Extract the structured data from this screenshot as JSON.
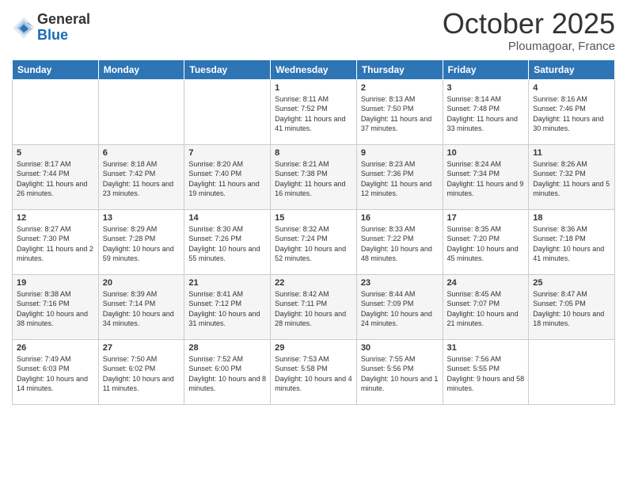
{
  "logo": {
    "general": "General",
    "blue": "Blue"
  },
  "title": "October 2025",
  "location": "Ploumagoar, France",
  "days_of_week": [
    "Sunday",
    "Monday",
    "Tuesday",
    "Wednesday",
    "Thursday",
    "Friday",
    "Saturday"
  ],
  "weeks": [
    [
      {
        "day": "",
        "sunrise": "",
        "sunset": "",
        "daylight": ""
      },
      {
        "day": "",
        "sunrise": "",
        "sunset": "",
        "daylight": ""
      },
      {
        "day": "",
        "sunrise": "",
        "sunset": "",
        "daylight": ""
      },
      {
        "day": "1",
        "sunrise": "Sunrise: 8:11 AM",
        "sunset": "Sunset: 7:52 PM",
        "daylight": "Daylight: 11 hours and 41 minutes."
      },
      {
        "day": "2",
        "sunrise": "Sunrise: 8:13 AM",
        "sunset": "Sunset: 7:50 PM",
        "daylight": "Daylight: 11 hours and 37 minutes."
      },
      {
        "day": "3",
        "sunrise": "Sunrise: 8:14 AM",
        "sunset": "Sunset: 7:48 PM",
        "daylight": "Daylight: 11 hours and 33 minutes."
      },
      {
        "day": "4",
        "sunrise": "Sunrise: 8:16 AM",
        "sunset": "Sunset: 7:46 PM",
        "daylight": "Daylight: 11 hours and 30 minutes."
      }
    ],
    [
      {
        "day": "5",
        "sunrise": "Sunrise: 8:17 AM",
        "sunset": "Sunset: 7:44 PM",
        "daylight": "Daylight: 11 hours and 26 minutes."
      },
      {
        "day": "6",
        "sunrise": "Sunrise: 8:18 AM",
        "sunset": "Sunset: 7:42 PM",
        "daylight": "Daylight: 11 hours and 23 minutes."
      },
      {
        "day": "7",
        "sunrise": "Sunrise: 8:20 AM",
        "sunset": "Sunset: 7:40 PM",
        "daylight": "Daylight: 11 hours and 19 minutes."
      },
      {
        "day": "8",
        "sunrise": "Sunrise: 8:21 AM",
        "sunset": "Sunset: 7:38 PM",
        "daylight": "Daylight: 11 hours and 16 minutes."
      },
      {
        "day": "9",
        "sunrise": "Sunrise: 8:23 AM",
        "sunset": "Sunset: 7:36 PM",
        "daylight": "Daylight: 11 hours and 12 minutes."
      },
      {
        "day": "10",
        "sunrise": "Sunrise: 8:24 AM",
        "sunset": "Sunset: 7:34 PM",
        "daylight": "Daylight: 11 hours and 9 minutes."
      },
      {
        "day": "11",
        "sunrise": "Sunrise: 8:26 AM",
        "sunset": "Sunset: 7:32 PM",
        "daylight": "Daylight: 11 hours and 5 minutes."
      }
    ],
    [
      {
        "day": "12",
        "sunrise": "Sunrise: 8:27 AM",
        "sunset": "Sunset: 7:30 PM",
        "daylight": "Daylight: 11 hours and 2 minutes."
      },
      {
        "day": "13",
        "sunrise": "Sunrise: 8:29 AM",
        "sunset": "Sunset: 7:28 PM",
        "daylight": "Daylight: 10 hours and 59 minutes."
      },
      {
        "day": "14",
        "sunrise": "Sunrise: 8:30 AM",
        "sunset": "Sunset: 7:26 PM",
        "daylight": "Daylight: 10 hours and 55 minutes."
      },
      {
        "day": "15",
        "sunrise": "Sunrise: 8:32 AM",
        "sunset": "Sunset: 7:24 PM",
        "daylight": "Daylight: 10 hours and 52 minutes."
      },
      {
        "day": "16",
        "sunrise": "Sunrise: 8:33 AM",
        "sunset": "Sunset: 7:22 PM",
        "daylight": "Daylight: 10 hours and 48 minutes."
      },
      {
        "day": "17",
        "sunrise": "Sunrise: 8:35 AM",
        "sunset": "Sunset: 7:20 PM",
        "daylight": "Daylight: 10 hours and 45 minutes."
      },
      {
        "day": "18",
        "sunrise": "Sunrise: 8:36 AM",
        "sunset": "Sunset: 7:18 PM",
        "daylight": "Daylight: 10 hours and 41 minutes."
      }
    ],
    [
      {
        "day": "19",
        "sunrise": "Sunrise: 8:38 AM",
        "sunset": "Sunset: 7:16 PM",
        "daylight": "Daylight: 10 hours and 38 minutes."
      },
      {
        "day": "20",
        "sunrise": "Sunrise: 8:39 AM",
        "sunset": "Sunset: 7:14 PM",
        "daylight": "Daylight: 10 hours and 34 minutes."
      },
      {
        "day": "21",
        "sunrise": "Sunrise: 8:41 AM",
        "sunset": "Sunset: 7:12 PM",
        "daylight": "Daylight: 10 hours and 31 minutes."
      },
      {
        "day": "22",
        "sunrise": "Sunrise: 8:42 AM",
        "sunset": "Sunset: 7:11 PM",
        "daylight": "Daylight: 10 hours and 28 minutes."
      },
      {
        "day": "23",
        "sunrise": "Sunrise: 8:44 AM",
        "sunset": "Sunset: 7:09 PM",
        "daylight": "Daylight: 10 hours and 24 minutes."
      },
      {
        "day": "24",
        "sunrise": "Sunrise: 8:45 AM",
        "sunset": "Sunset: 7:07 PM",
        "daylight": "Daylight: 10 hours and 21 minutes."
      },
      {
        "day": "25",
        "sunrise": "Sunrise: 8:47 AM",
        "sunset": "Sunset: 7:05 PM",
        "daylight": "Daylight: 10 hours and 18 minutes."
      }
    ],
    [
      {
        "day": "26",
        "sunrise": "Sunrise: 7:49 AM",
        "sunset": "Sunset: 6:03 PM",
        "daylight": "Daylight: 10 hours and 14 minutes."
      },
      {
        "day": "27",
        "sunrise": "Sunrise: 7:50 AM",
        "sunset": "Sunset: 6:02 PM",
        "daylight": "Daylight: 10 hours and 11 minutes."
      },
      {
        "day": "28",
        "sunrise": "Sunrise: 7:52 AM",
        "sunset": "Sunset: 6:00 PM",
        "daylight": "Daylight: 10 hours and 8 minutes."
      },
      {
        "day": "29",
        "sunrise": "Sunrise: 7:53 AM",
        "sunset": "Sunset: 5:58 PM",
        "daylight": "Daylight: 10 hours and 4 minutes."
      },
      {
        "day": "30",
        "sunrise": "Sunrise: 7:55 AM",
        "sunset": "Sunset: 5:56 PM",
        "daylight": "Daylight: 10 hours and 1 minute."
      },
      {
        "day": "31",
        "sunrise": "Sunrise: 7:56 AM",
        "sunset": "Sunset: 5:55 PM",
        "daylight": "Daylight: 9 hours and 58 minutes."
      },
      {
        "day": "",
        "sunrise": "",
        "sunset": "",
        "daylight": ""
      }
    ]
  ]
}
